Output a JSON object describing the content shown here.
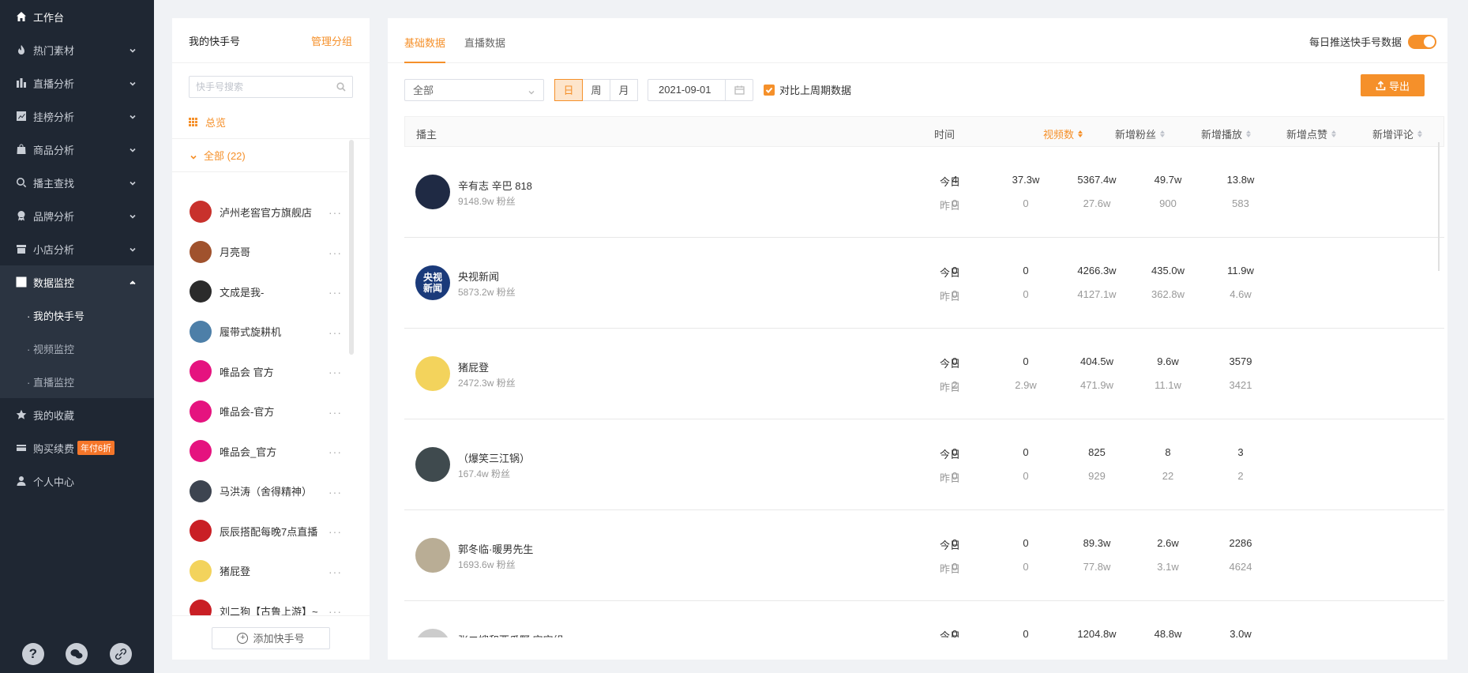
{
  "sidebar": {
    "items": [
      {
        "label": "工作台",
        "icon": "home-icon"
      },
      {
        "label": "热门素材",
        "icon": "fire-icon"
      },
      {
        "label": "直播分析",
        "icon": "bar-chart-icon"
      },
      {
        "label": "挂榜分析",
        "icon": "line-chart-icon"
      },
      {
        "label": "商品分析",
        "icon": "bag-icon"
      },
      {
        "label": "播主查找",
        "icon": "search-icon"
      },
      {
        "label": "品牌分析",
        "icon": "award-icon"
      },
      {
        "label": "小店分析",
        "icon": "store-icon"
      },
      {
        "label": "数据监控",
        "icon": "monitor-icon"
      }
    ],
    "sub_items": [
      {
        "label": "· 我的快手号"
      },
      {
        "label": "· 视频监控"
      },
      {
        "label": "· 直播监控"
      }
    ],
    "bottom_items": [
      {
        "label": "我的收藏",
        "icon": "star-icon"
      },
      {
        "label": "购买续费",
        "icon": "card-icon",
        "badge": "年付6折"
      },
      {
        "label": "个人中心",
        "icon": "user-icon"
      }
    ],
    "footer_icons": [
      "help-icon",
      "wechat-icon",
      "link-icon"
    ],
    "help_glyph": "?"
  },
  "accounts": {
    "title": "我的快手号",
    "manage": "管理分组",
    "search_placeholder": "快手号搜索",
    "overview": "总览",
    "group": "全部 (22)",
    "list": [
      {
        "name": "泸州老窖官方旗舰店",
        "avatar_color": "#c8312c"
      },
      {
        "name": "月亮哥",
        "avatar_color": "#a0522d"
      },
      {
        "name": "文成是我-",
        "avatar_color": "#2b2b2b"
      },
      {
        "name": "履带式旋耕机",
        "avatar_color": "#4d7fa8"
      },
      {
        "name": "唯品会 官方",
        "avatar_color": "#e5137f"
      },
      {
        "name": "唯品会-官方",
        "avatar_color": "#e5137f"
      },
      {
        "name": "唯品会_官方",
        "avatar_color": "#e5137f"
      },
      {
        "name": "马洪涛（舍得精神）",
        "avatar_color": "#3d4450"
      },
      {
        "name": "辰辰搭配每晚7点直播",
        "avatar_color": "#c91f25"
      },
      {
        "name": "猪屁登",
        "avatar_color": "#f3d35c"
      },
      {
        "name": "刘二狗【古鲁上游】~",
        "avatar_color": "#c91f25"
      }
    ],
    "add_button": "添加快手号",
    "more_glyph": "···"
  },
  "main": {
    "tabs": [
      {
        "label": "基础数据",
        "active": true
      },
      {
        "label": "直播数据",
        "active": false
      }
    ],
    "push_label": "每日推送快手号数据",
    "push_on": true,
    "filter": {
      "select_value": "全部",
      "periods": [
        "日",
        "周",
        "月"
      ],
      "active_period": "日",
      "date": "2021-09-01",
      "compare_label": "对比上周期数据",
      "compare_checked": true,
      "export_label": "导出"
    },
    "table": {
      "headers": {
        "anchor": "播主",
        "time": "时间",
        "videos": "视频数",
        "fans": "新增粉丝",
        "plays": "新增播放",
        "likes": "新增点赞",
        "comments": "新增评论"
      },
      "sorted_column": "videos",
      "today_label": "今日",
      "yesterday_label": "昨日",
      "rows": [
        {
          "name": "辛有志 辛巴 818",
          "fans": "9148.9w 粉丝",
          "avatar_color": "#1f2a44",
          "today": [
            "4",
            "37.3w",
            "5367.4w",
            "49.7w",
            "13.8w"
          ],
          "yesterday": [
            "0",
            "0",
            "27.6w",
            "900",
            "583"
          ]
        },
        {
          "name": "央视新闻",
          "fans": "5873.2w 粉丝",
          "avatar_color": "#1a3a7a",
          "avatar_text": "央视新闻",
          "today": [
            "0",
            "0",
            "4266.3w",
            "435.0w",
            "11.9w"
          ],
          "yesterday": [
            "0",
            "0",
            "4127.1w",
            "362.8w",
            "4.6w"
          ]
        },
        {
          "name": "猪屁登",
          "fans": "2472.3w 粉丝",
          "avatar_color": "#f3d35c",
          "today": [
            "0",
            "0",
            "404.5w",
            "9.6w",
            "3579"
          ],
          "yesterday": [
            "2",
            "2.9w",
            "471.9w",
            "11.1w",
            "3421"
          ]
        },
        {
          "name": "（爆笑三江锅）",
          "fans": "167.4w 粉丝",
          "avatar_color": "#3f4a4e",
          "today": [
            "0",
            "0",
            "825",
            "8",
            "3"
          ],
          "yesterday": [
            "0",
            "0",
            "929",
            "22",
            "2"
          ]
        },
        {
          "name": "郭冬临·暖男先生",
          "fans": "1693.6w 粉丝",
          "avatar_color": "#b9ad95",
          "today": [
            "0",
            "0",
            "89.3w",
            "2.6w",
            "2286"
          ],
          "yesterday": [
            "0",
            "0",
            "77.8w",
            "3.1w",
            "4624"
          ]
        },
        {
          "name": "张二嫂和西瓜野 宝宝组",
          "fans": "",
          "avatar_color": "#cccccc",
          "today": [
            "0",
            "0",
            "1204.8w",
            "48.8w",
            "3.0w"
          ],
          "yesterday": [
            "",
            "",
            "",
            "",
            ""
          ]
        }
      ]
    }
  },
  "colors": {
    "accent": "#f5902a",
    "sidebar_bg": "#1f2733",
    "badge": "#f5762a"
  }
}
